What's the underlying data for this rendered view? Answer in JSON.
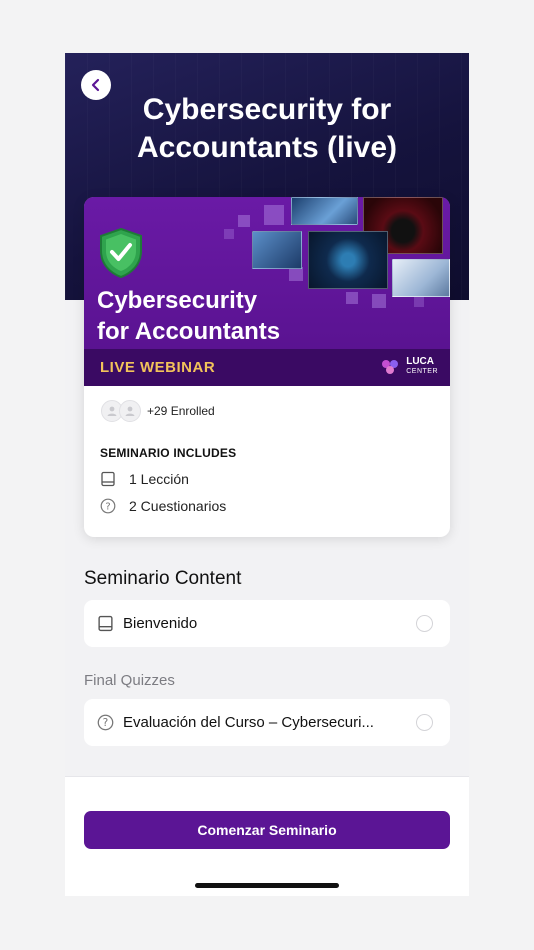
{
  "header": {
    "title": "Cybersecurity for Accountants (live)"
  },
  "banner": {
    "title_line1": "Cybersecurity",
    "title_line2": "for Accountants",
    "tag": "LIVE WEBINAR",
    "brand": "LUCA",
    "brand_sub": "CENTER"
  },
  "enrollment": {
    "text": "+29 Enrolled"
  },
  "includes": {
    "title": "SEMINARIO INCLUDES",
    "items": [
      {
        "icon": "book-icon",
        "label": "1 Lección"
      },
      {
        "icon": "question-icon",
        "label": "2 Cuestionarios"
      }
    ]
  },
  "content": {
    "title": "Seminario Content",
    "lessons": [
      {
        "icon": "book-icon",
        "label": "Bienvenido"
      }
    ]
  },
  "quizzes": {
    "title": "Final Quizzes",
    "items": [
      {
        "icon": "question-icon",
        "label": "Evaluación del Curso – Cybersecuri..."
      }
    ]
  },
  "cta": {
    "label": "Comenzar Seminario"
  },
  "colors": {
    "brand_purple": "#5b1595",
    "hero_navy": "#1a1845",
    "accent_gold": "#f2c35a"
  }
}
